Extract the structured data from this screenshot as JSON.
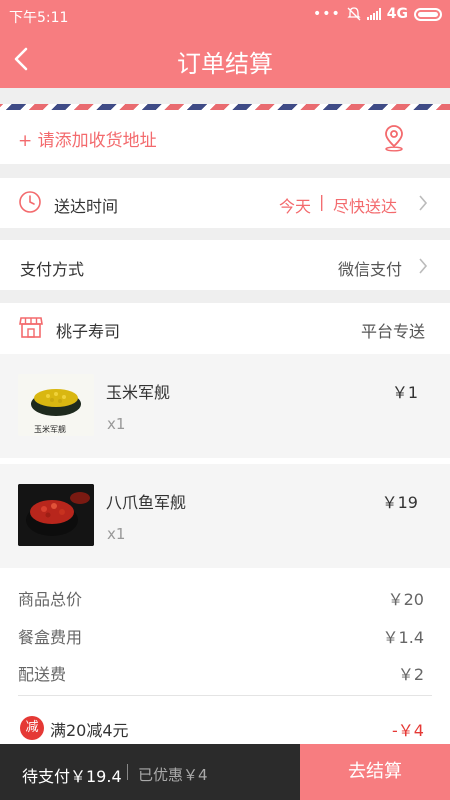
{
  "status_bar": {
    "time": "下午5:11",
    "network": "4G"
  },
  "header": {
    "title": "订单结算"
  },
  "address": {
    "add_label": "+ 请添加收货地址"
  },
  "delivery": {
    "label": "送达时间",
    "day": "今天",
    "separator": "|",
    "option": "尽快送达"
  },
  "payment": {
    "label": "支付方式",
    "method": "微信支付"
  },
  "shop": {
    "name": "桃子寿司",
    "delivery_type": "平台专送"
  },
  "items": [
    {
      "name": "玉米军舰",
      "qty": "x1",
      "price": "￥1",
      "thumb_caption": "玉米军舰"
    },
    {
      "name": "八爪鱼军舰",
      "qty": "x1",
      "price": "￥19"
    }
  ],
  "fees": [
    {
      "label": "商品总价",
      "value": "￥20"
    },
    {
      "label": "餐盒费用",
      "value": "￥1.4"
    },
    {
      "label": "配送费",
      "value": "￥2"
    }
  ],
  "promotion": {
    "badge": "减",
    "text": "满20减4元",
    "amount": "-￥4"
  },
  "footer": {
    "to_pay": "待支付￥19.4",
    "saved": "已优惠￥4",
    "checkout": "去结算"
  },
  "colors": {
    "accent": "#f77d80",
    "promo_red": "#e53935",
    "footer_dark": "#2b2b2b"
  }
}
